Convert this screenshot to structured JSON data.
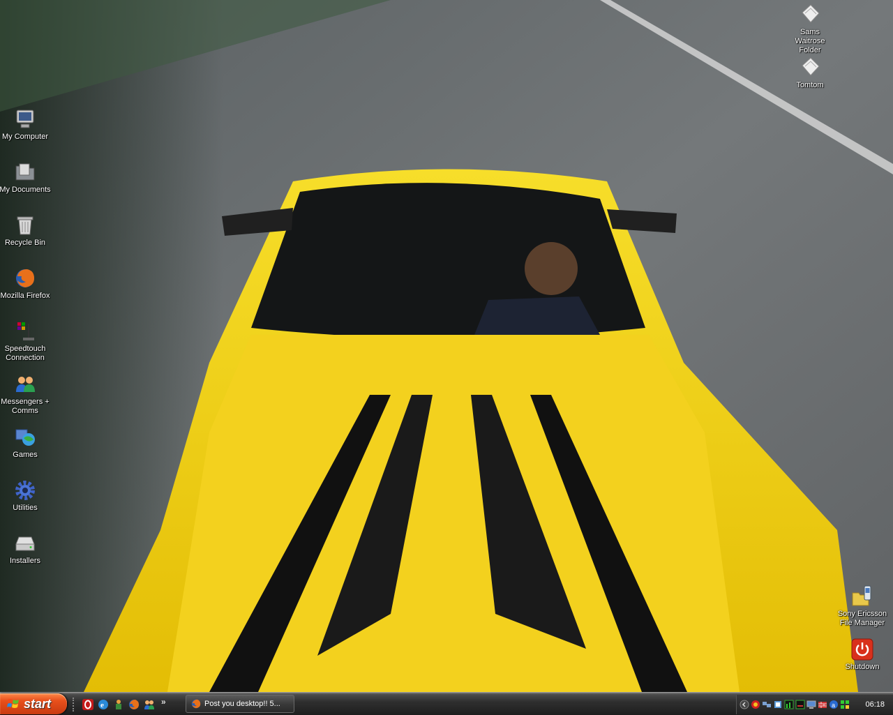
{
  "desktop": {
    "left_icons": [
      {
        "label": "My Computer",
        "icon": "computer-icon"
      },
      {
        "label": "My Documents",
        "icon": "documents-folder-icon"
      },
      {
        "label": "Recycle Bin",
        "icon": "recycle-bin-icon"
      },
      {
        "label": "Mozilla Firefox",
        "icon": "firefox-icon"
      },
      {
        "label": "Speedtouch Connection",
        "icon": "network-connection-icon"
      },
      {
        "label": "Messengers + Comms",
        "icon": "messenger-icon"
      },
      {
        "label": "Games",
        "icon": "games-icon"
      },
      {
        "label": "Utilities",
        "icon": "gear-icon"
      },
      {
        "label": "Installers",
        "icon": "drive-icon"
      }
    ],
    "right_icons": [
      {
        "label": "Sams Waitrose Folder",
        "icon": "document-icon"
      },
      {
        "label": "Tomtom",
        "icon": "document-icon"
      },
      {
        "label": "Sony Ericsson File Manager",
        "icon": "phone-folder-icon"
      },
      {
        "label": "Shutdown",
        "icon": "power-icon"
      }
    ]
  },
  "taskbar": {
    "start_label": "start",
    "quick_launch": [
      "opera-icon",
      "ie-icon",
      "msn-icon",
      "firefox-icon",
      "messenger-icon"
    ],
    "overflow": "»",
    "tasks": [
      {
        "label": "Post you desktop!! 5...",
        "icon": "firefox-icon"
      }
    ],
    "clock": "06:18"
  },
  "colors": {
    "car": "#f2d21a",
    "road": "#6b6e70",
    "taskbar": "#2a2a2a",
    "start": "#e8501c"
  }
}
